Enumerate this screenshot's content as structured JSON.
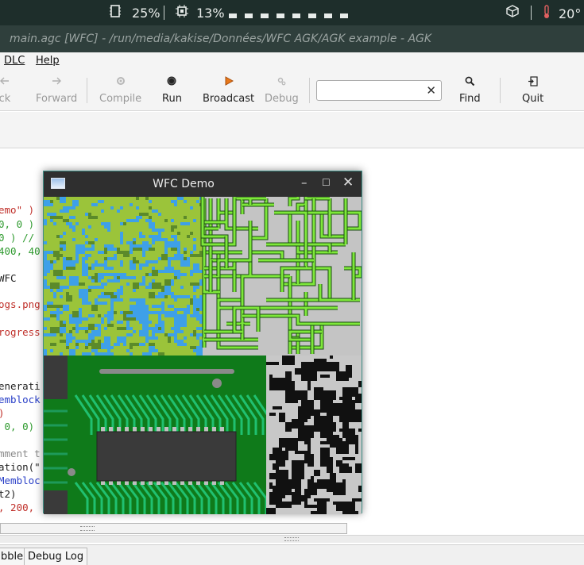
{
  "system_panel": {
    "memory_pct": "25%",
    "cpu_pct": "13%",
    "temperature": "20°",
    "colors": {
      "background": "#1e2e2b",
      "text": "#e8ecea"
    },
    "icons": [
      "memory-icon",
      "cpu-icon",
      "package-icon",
      "thermometer-icon"
    ]
  },
  "main_window": {
    "title": "main.agc [WFC] - /run/media/kakise/Données/WFC AGK/AGK example - AGK"
  },
  "menu": {
    "items": [
      {
        "label": "DLC"
      },
      {
        "label": "Help"
      }
    ]
  },
  "toolbar": {
    "buttons": [
      {
        "label": "ck",
        "icon": "arrow-left-icon",
        "enabled": false
      },
      {
        "label": "Forward",
        "icon": "arrow-right-icon",
        "enabled": false
      },
      {
        "label": "Compile",
        "icon": "gear-icon",
        "enabled": false
      },
      {
        "label": "Run",
        "icon": "record-icon",
        "enabled": true
      },
      {
        "label": "Broadcast",
        "icon": "play-icon",
        "enabled": true
      },
      {
        "label": "Debug",
        "icon": "debug-icon",
        "enabled": false
      },
      {
        "label": "Find",
        "icon": "search-icon",
        "enabled": true
      },
      {
        "label": "Quit",
        "icon": "exit-icon",
        "enabled": true
      }
    ],
    "search": {
      "value": "",
      "placeholder": ""
    }
  },
  "editor": {
    "lines": [
      {
        "text": "emo\" )"
      },
      {
        "text": "0, 0 )"
      },
      {
        "text": "0 ) //"
      },
      {
        "text": "400, 40"
      },
      {
        "text": "WFC"
      },
      {
        "text": "ogs.png"
      },
      {
        "text": "rogress"
      },
      {
        "text": "enerati"
      },
      {
        "text": "emblock"
      },
      {
        "text": ")"
      },
      {
        "text": " 0, 0)"
      },
      {
        "text": "mment t"
      },
      {
        "text": "ation(\""
      },
      {
        "text": "Membloc"
      },
      {
        "text": "t2)"
      },
      {
        "text": ", 200,"
      }
    ]
  },
  "bottom_tabs": [
    {
      "label": "bble"
    },
    {
      "label": "Debug Log"
    }
  ],
  "wfc_window": {
    "title": "WFC Demo",
    "quadrants": [
      "terrain",
      "circuit-maze",
      "circuit-board",
      "noise-blocks"
    ],
    "colors": {
      "water": "#3ea0e8",
      "grass": "#9bc43a",
      "maze_bg": "#c4c4c4",
      "maze_line": "#7ee83a",
      "board": "#0f7a1a",
      "trace": "#20c070",
      "chip": "#3a3a3a",
      "noise_bg": "#c8c8c8",
      "noise_fg": "#111111"
    }
  }
}
